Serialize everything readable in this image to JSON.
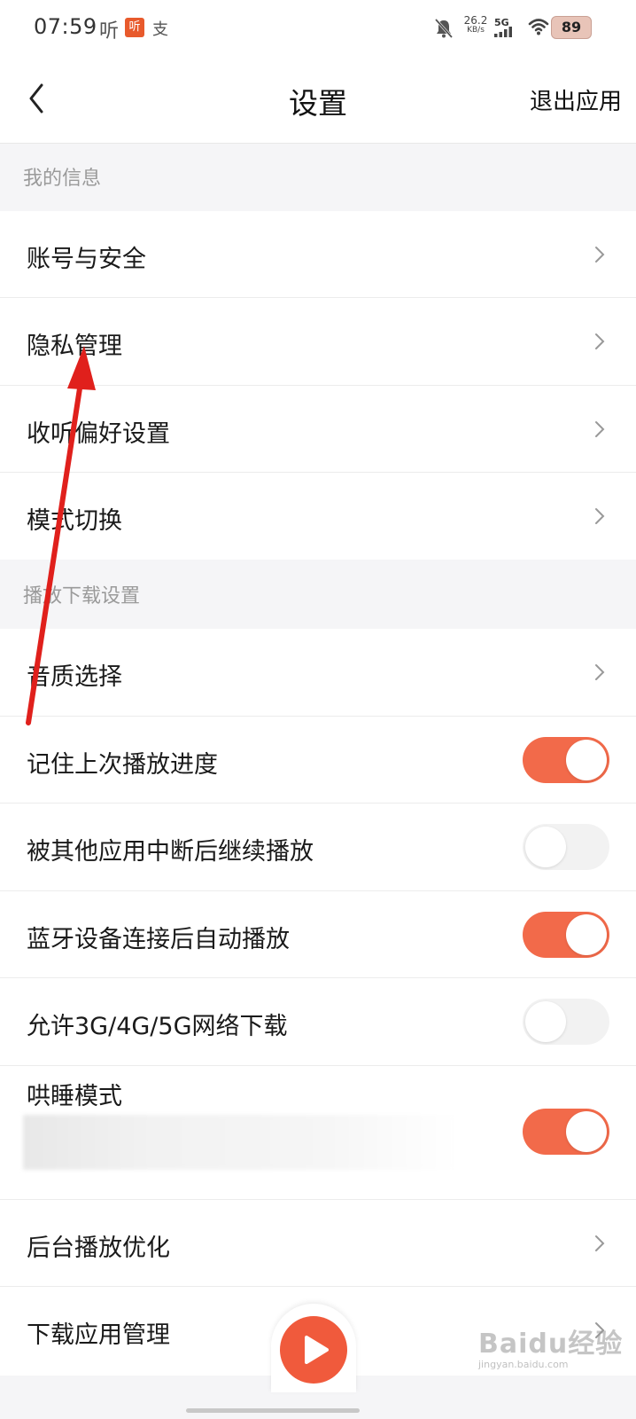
{
  "status_bar": {
    "time": "07:59",
    "app_icon_1": "听",
    "app_icon_2": "听",
    "app_icon_3": "支",
    "net_speed_value": "26.2",
    "net_speed_unit": "KB/s",
    "network_type": "5G",
    "battery": "89",
    "icons": [
      "mute-bell-icon",
      "signal-icon",
      "wifi-icon",
      "battery-icon"
    ]
  },
  "header": {
    "title": "设置",
    "exit_label": "退出应用",
    "back_icon": "chevron-left-icon"
  },
  "sections": [
    {
      "title": "我的信息",
      "rows": [
        {
          "label": "账号与安全",
          "control": "chevron"
        },
        {
          "label": "隐私管理",
          "control": "chevron"
        },
        {
          "label": "收听偏好设置",
          "control": "chevron"
        },
        {
          "label": "模式切换",
          "control": "chevron"
        }
      ]
    },
    {
      "title": "播放下载设置",
      "rows": [
        {
          "label": "音质选择",
          "control": "chevron"
        },
        {
          "label": "记住上次播放进度",
          "control": "toggle",
          "on": true
        },
        {
          "label": "被其他应用中断后继续播放",
          "control": "toggle",
          "on": false
        },
        {
          "label": "蓝牙设备连接后自动播放",
          "control": "toggle",
          "on": true
        },
        {
          "label": "允许3G/4G/5G网络下载",
          "control": "toggle",
          "on": false
        },
        {
          "label": "哄睡模式",
          "control": "toggle",
          "on": true
        },
        {
          "label": "后台播放优化",
          "control": "chevron"
        },
        {
          "label": "下载应用管理",
          "control": "chevron"
        }
      ]
    }
  ],
  "colors": {
    "accent": "#f26a4a",
    "section_bg": "#f5f5f7",
    "section_text": "#9a9a9a",
    "annotation_arrow": "#e0201c"
  },
  "watermark": {
    "text": "Baidu经验",
    "sub": "jingyan.baidu.com"
  }
}
